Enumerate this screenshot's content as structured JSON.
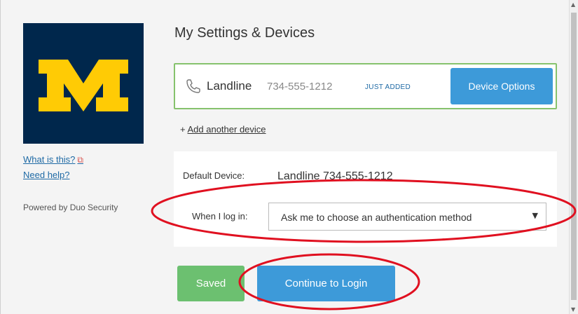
{
  "sidebar": {
    "what_is_this": "What is this?",
    "need_help": "Need help?",
    "powered_by": "Powered by Duo Security",
    "logo_letter": "M"
  },
  "main": {
    "title": "My Settings & Devices",
    "device": {
      "name": "Landline",
      "number": "734-555-1212",
      "badge": "JUST ADDED",
      "options_button": "Device Options"
    },
    "add_device_prefix": "+ ",
    "add_device_link": "Add another device",
    "default_device_label": "Default Device:",
    "default_device_value": "Landline 734-555-1212",
    "login_label": "When I log in:",
    "login_select_value": "Ask me to choose an authentication method",
    "saved_button": "Saved",
    "continue_button": "Continue to Login"
  },
  "colors": {
    "logo_bg": "#00274c",
    "logo_maize": "#ffcb05",
    "accent_blue": "#3d9ad9",
    "saved_green": "#6cc070",
    "card_border": "#86c26d",
    "annotation_red": "#e01020"
  }
}
